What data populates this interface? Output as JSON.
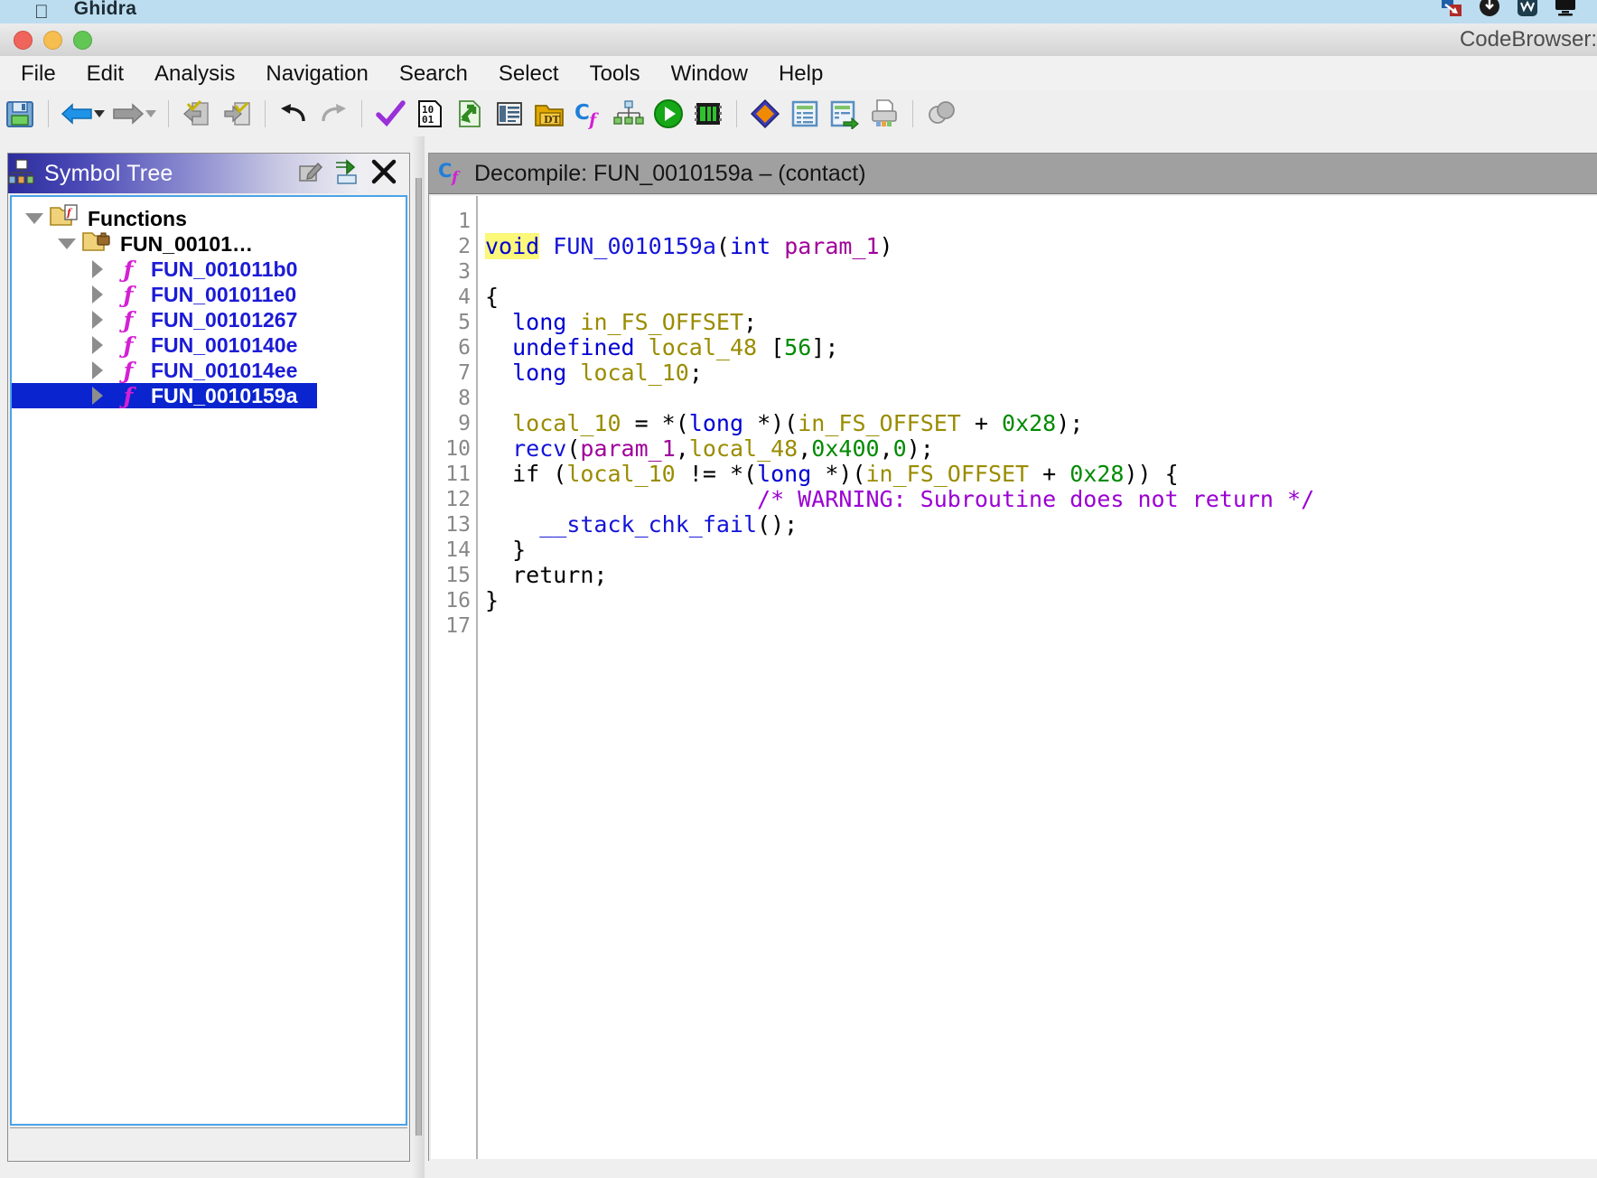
{
  "macbar": {
    "apple_icon": "apple-logo-icon",
    "app_name": "Ghidra",
    "tray_icons": [
      "screen-share-icon",
      "download-arrow-icon",
      "wacom-icon",
      "display-icon"
    ]
  },
  "window": {
    "title": "CodeBrowser: ",
    "traffic_lights": [
      "close-button",
      "minimize-button",
      "zoom-button"
    ]
  },
  "menu": {
    "items": [
      "File",
      "Edit",
      "Analysis",
      "Navigation",
      "Search",
      "Select",
      "Tools",
      "Window",
      "Help"
    ]
  },
  "toolbar": {
    "buttons": [
      "save-icon",
      "back-arrow-icon",
      "back-dropdown-icon",
      "forward-arrow-icon",
      "forward-dropdown-icon",
      "previous-function-icon",
      "next-function-icon",
      "undo-icon",
      "redo-icon",
      "check-icon",
      "binary-icon",
      "import-icon",
      "memory-map-icon",
      "data-type-manager-icon",
      "decompiler-icon",
      "function-graph-icon",
      "run-icon",
      "processor-icon",
      "diamond-icon",
      "listing-icon",
      "snapshot-listing-icon",
      "print-icon",
      "overlap-icon"
    ]
  },
  "symbol_tree": {
    "title": "Symbol Tree",
    "header_buttons": [
      "edit-icon",
      "collapse-icon",
      "close-icon"
    ],
    "nodes": [
      {
        "label": "Functions",
        "type": "folder",
        "indent": 0,
        "twisty": "down",
        "icon": "functions-folder-icon",
        "selected": false,
        "bold": true
      },
      {
        "label": "FUN_00101…",
        "type": "folder",
        "indent": 1,
        "twisty": "down",
        "icon": "namespace-folder-icon",
        "selected": false,
        "bold": true
      },
      {
        "label": "FUN_001011b0",
        "type": "function",
        "indent": 2,
        "twisty": "right",
        "icon": "function-icon",
        "selected": false,
        "bold": false
      },
      {
        "label": "FUN_001011e0",
        "type": "function",
        "indent": 2,
        "twisty": "right",
        "icon": "function-icon",
        "selected": false,
        "bold": false
      },
      {
        "label": "FUN_00101267",
        "type": "function",
        "indent": 2,
        "twisty": "right",
        "icon": "function-icon",
        "selected": false,
        "bold": false
      },
      {
        "label": "FUN_0010140e",
        "type": "function",
        "indent": 2,
        "twisty": "right",
        "icon": "function-icon",
        "selected": false,
        "bold": false
      },
      {
        "label": "FUN_001014ee",
        "type": "function",
        "indent": 2,
        "twisty": "right",
        "icon": "function-icon",
        "selected": false,
        "bold": false
      },
      {
        "label": "FUN_0010159a",
        "type": "function",
        "indent": 2,
        "twisty": "right",
        "icon": "function-icon",
        "selected": true,
        "bold": false
      }
    ]
  },
  "decompile": {
    "title": "Decompile: FUN_0010159a –  (contact)",
    "icon": "decompiler-c-icon",
    "function_name": "FUN_0010159a",
    "binary_name": "contact",
    "line_numbers": [
      "1",
      "2",
      "3",
      "4",
      "5",
      "6",
      "7",
      "8",
      "9",
      "10",
      "11",
      "12",
      "13",
      "14",
      "15",
      "16",
      "17"
    ],
    "code_lines": [
      {
        "n": 1,
        "text": ""
      },
      {
        "n": 2,
        "text": "void FUN_0010159a(int param_1)"
      },
      {
        "n": 3,
        "text": ""
      },
      {
        "n": 4,
        "text": "{"
      },
      {
        "n": 5,
        "text": "  long in_FS_OFFSET;"
      },
      {
        "n": 6,
        "text": "  undefined local_48 [56];"
      },
      {
        "n": 7,
        "text": "  long local_10;"
      },
      {
        "n": 8,
        "text": ""
      },
      {
        "n": 9,
        "text": "  local_10 = *(long *)(in_FS_OFFSET + 0x28);"
      },
      {
        "n": 10,
        "text": "  recv(param_1,local_48,0x400,0);"
      },
      {
        "n": 11,
        "text": "  if (local_10 != *(long *)(in_FS_OFFSET + 0x28)) {"
      },
      {
        "n": 12,
        "text": "                    /* WARNING: Subroutine does not return */"
      },
      {
        "n": 13,
        "text": "    __stack_chk_fail();"
      },
      {
        "n": 14,
        "text": "  }"
      },
      {
        "n": 15,
        "text": "  return;"
      },
      {
        "n": 16,
        "text": "}"
      },
      {
        "n": 17,
        "text": ""
      }
    ]
  },
  "colors": {
    "keyword_type": "#0000d2",
    "function_name": "#1414d8",
    "variable": "#9a8c00",
    "number": "#008a00",
    "parameter": "#a0009a",
    "comment": "#9a00d2",
    "selection_bg": "#0a24cf",
    "highlight_bg": "#fbf87a",
    "caret": "#f3887c",
    "panel_active_border": "#4aa3e8",
    "menubar_bg": "#bcdcef"
  }
}
